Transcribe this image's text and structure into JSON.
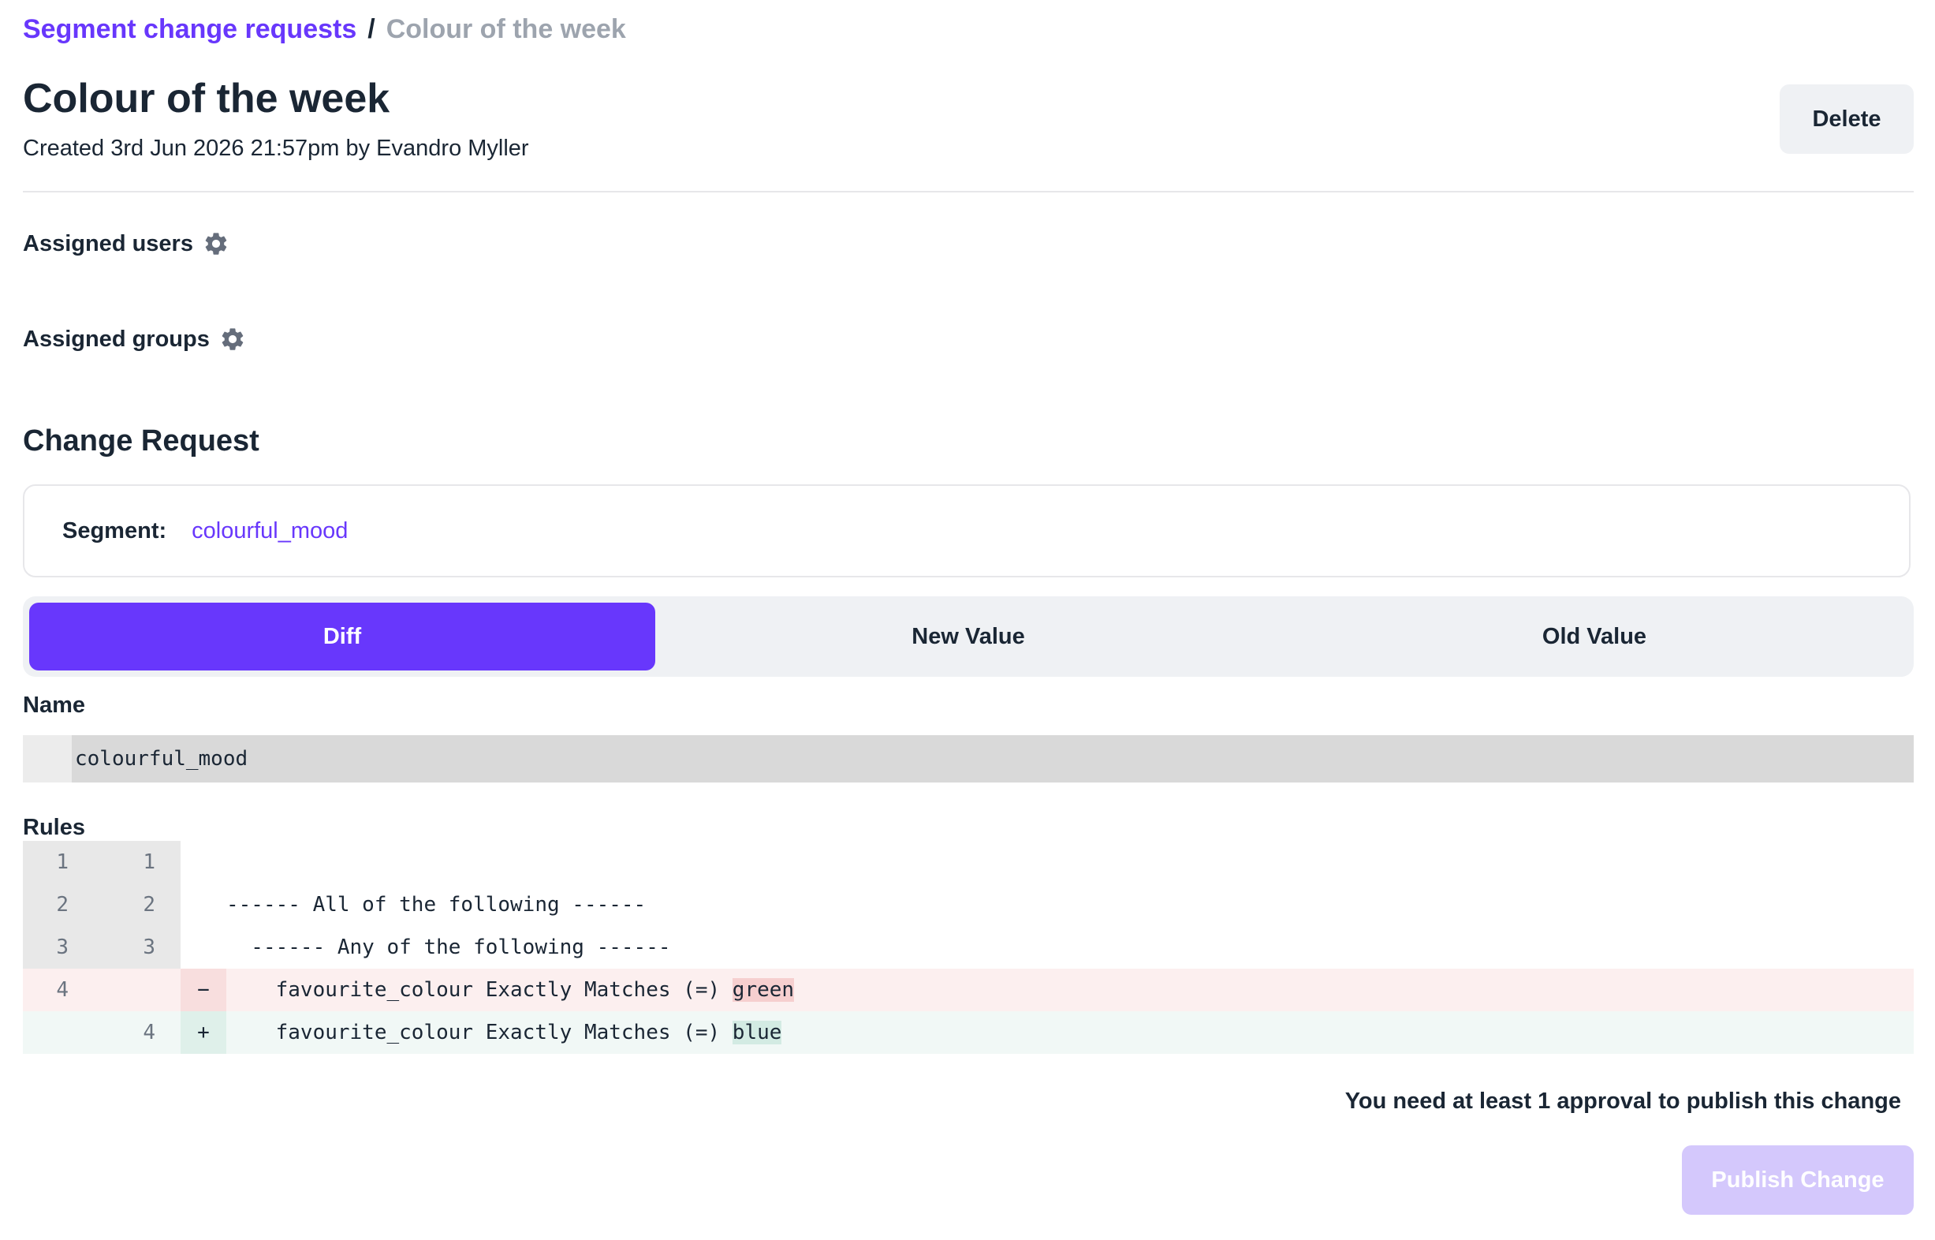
{
  "breadcrumb": {
    "parent": "Segment change requests",
    "separator": "/",
    "current": "Colour of the week"
  },
  "header": {
    "title": "Colour of the week",
    "created": "Created 3rd Jun 2026 21:57pm by Evandro Myller",
    "delete_label": "Delete"
  },
  "assigned_users": {
    "label": "Assigned users",
    "icon": "gear-icon"
  },
  "assigned_groups": {
    "label": "Assigned groups",
    "icon": "gear-icon"
  },
  "change_request": {
    "title": "Change Request",
    "segment_label": "Segment:",
    "segment_value": "colourful_mood",
    "tabs": [
      "Diff",
      "New Value",
      "Old Value"
    ],
    "active_tab": "Diff"
  },
  "name_section": {
    "label": "Name",
    "value": "colourful_mood"
  },
  "rules_section": {
    "label": "Rules",
    "lines": [
      {
        "old": "1",
        "new": "1",
        "sign": "",
        "code": "",
        "type": "context"
      },
      {
        "old": "2",
        "new": "2",
        "sign": "",
        "code": "------ All of the following ------",
        "type": "context"
      },
      {
        "old": "3",
        "new": "3",
        "sign": "",
        "code": "  ------ Any of the following ------",
        "type": "context"
      },
      {
        "old": "4",
        "new": "",
        "sign": "−",
        "code": "    favourite_colour Exactly Matches (=) ",
        "highlight": "green",
        "type": "removed"
      },
      {
        "old": "",
        "new": "4",
        "sign": "+",
        "code": "    favourite_colour Exactly Matches (=) ",
        "highlight": "blue",
        "type": "added"
      }
    ]
  },
  "footer": {
    "approval_note": "You need at least 1 approval to publish this change",
    "publish_label": "Publish Change"
  },
  "colors": {
    "accent": "#6837fc",
    "publish_disabled": "#d4c8fc",
    "removed_bg": "#fcefef",
    "added_bg": "#f1f8f6"
  }
}
